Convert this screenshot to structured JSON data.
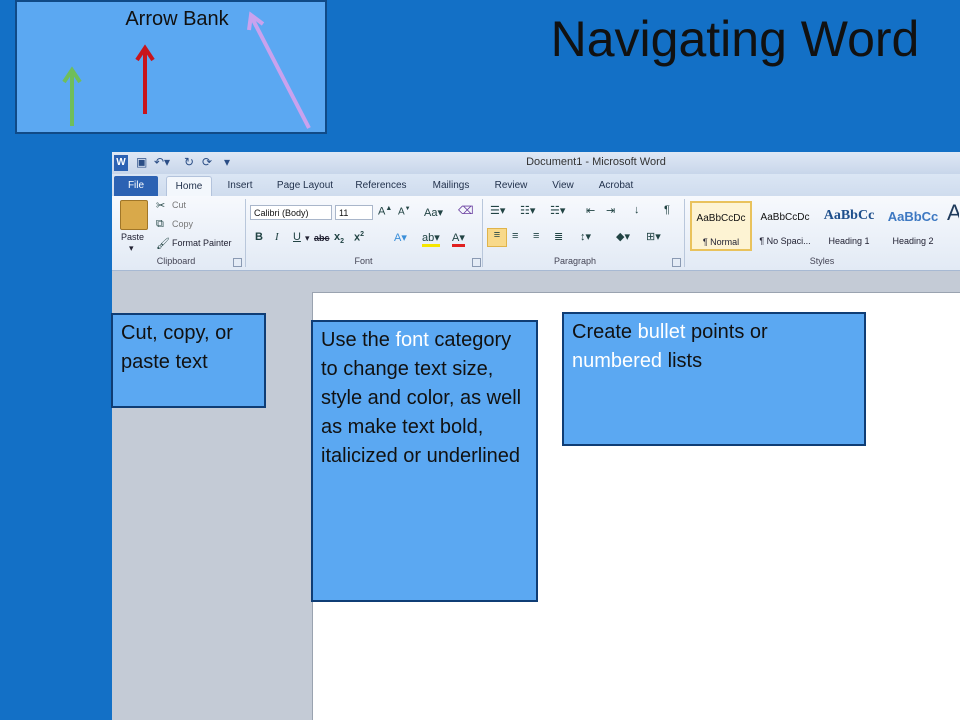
{
  "slide": {
    "title": "Navigating Word",
    "arrow_bank_label": "Arrow Bank",
    "arrow_colors": {
      "green": "#6fbe5b",
      "red": "#c8141c",
      "purple": "#c9a2ee"
    }
  },
  "word": {
    "doc_title": "Document1  -  Microsoft Word",
    "tabs": [
      "File",
      "Home",
      "Insert",
      "Page Layout",
      "References",
      "Mailings",
      "Review",
      "View",
      "Acrobat"
    ],
    "clipboard": {
      "paste": "Paste",
      "cut": "Cut",
      "copy": "Copy",
      "format_painter": "Format Painter",
      "label": "Clipboard"
    },
    "font": {
      "name": "Calibri (Body)",
      "size": "11",
      "label": "Font"
    },
    "paragraph": {
      "label": "Paragraph"
    },
    "styles": {
      "label": "Styles",
      "items": [
        {
          "sample": "AaBbCcDc",
          "name": "¶ Normal"
        },
        {
          "sample": "AaBbCcDc",
          "name": "¶ No Spaci..."
        },
        {
          "sample": "AaBbCc",
          "name": "Heading 1"
        },
        {
          "sample": "AaBbCc",
          "name": "Heading 2"
        },
        {
          "sample": "A",
          "name": ""
        }
      ]
    }
  },
  "callouts": {
    "clipboard": "Cut, copy, or paste text",
    "font_pre": "Use the ",
    "font_hl": "font",
    "font_post": " category to change text size, style and color, as well as make text bold, italicized or underlined",
    "para_pre": "Create ",
    "para_hl1": "bullet",
    "para_mid": " points or ",
    "para_hl2": "numbered",
    "para_post": " lists"
  },
  "colors": {
    "slide_bg": "#1370c6",
    "callout_fill": "#5ba8f2",
    "highlight_text": "#ffffff"
  }
}
